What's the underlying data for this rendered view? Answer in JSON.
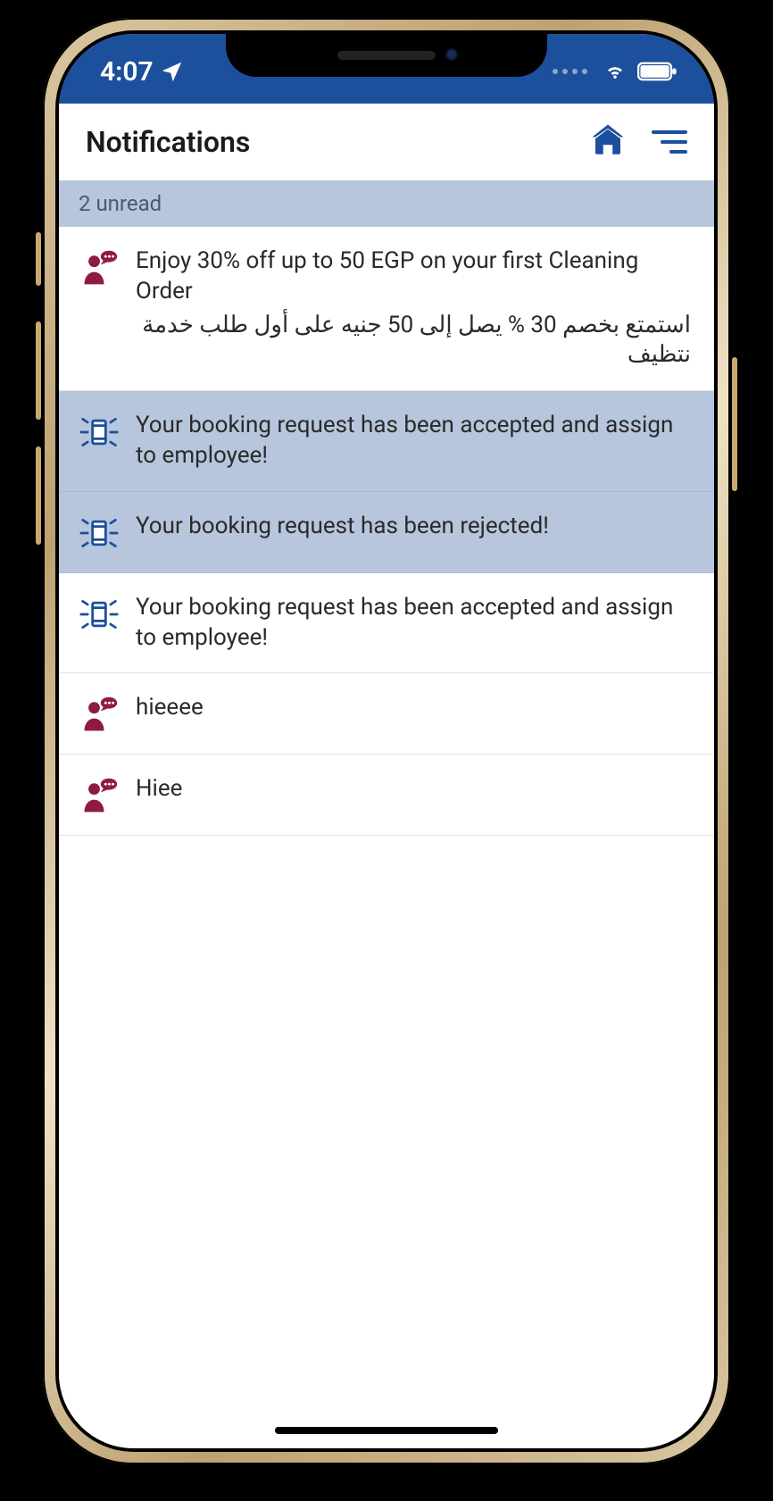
{
  "statusbar": {
    "time": "4:07",
    "location_icon": "location-arrow-icon",
    "wifi_icon": "wifi-icon",
    "battery_icon": "battery-icon",
    "signal_dots_icon": "signal-dots-icon"
  },
  "header": {
    "title": "Notifications",
    "home_icon": "home-icon",
    "filter_icon": "filter-icon"
  },
  "unread_label": "2 unread",
  "notifications": [
    {
      "icon": "person-speech-icon",
      "icon_color": "#8f1a46",
      "unread": false,
      "text_en": "Enjoy 30% off up to 50 EGP on your first Cleaning Order",
      "text_ar": "استمتع بخصم 30 % يصل إلى 50 جنيه على أول طلب خدمة نتظيف"
    },
    {
      "icon": "booking-icon",
      "icon_color": "#1c4f9c",
      "unread": true,
      "text_en": "Your booking request has been accepted and assign to employee!",
      "text_ar": ""
    },
    {
      "icon": "booking-icon",
      "icon_color": "#1c4f9c",
      "unread": true,
      "text_en": "Your booking request has been rejected!",
      "text_ar": ""
    },
    {
      "icon": "booking-icon",
      "icon_color": "#1c4f9c",
      "unread": false,
      "text_en": "Your booking request has been accepted and assign to employee!",
      "text_ar": ""
    },
    {
      "icon": "person-speech-icon",
      "icon_color": "#8f1a46",
      "unread": false,
      "text_en": "hieeee",
      "text_ar": ""
    },
    {
      "icon": "person-speech-icon",
      "icon_color": "#8f1a46",
      "unread": false,
      "text_en": "Hiee",
      "text_ar": ""
    }
  ],
  "colors": {
    "brand_blue": "#1c4f9c",
    "unread_bg": "#b7c6dc",
    "maroon": "#8f1a46"
  }
}
